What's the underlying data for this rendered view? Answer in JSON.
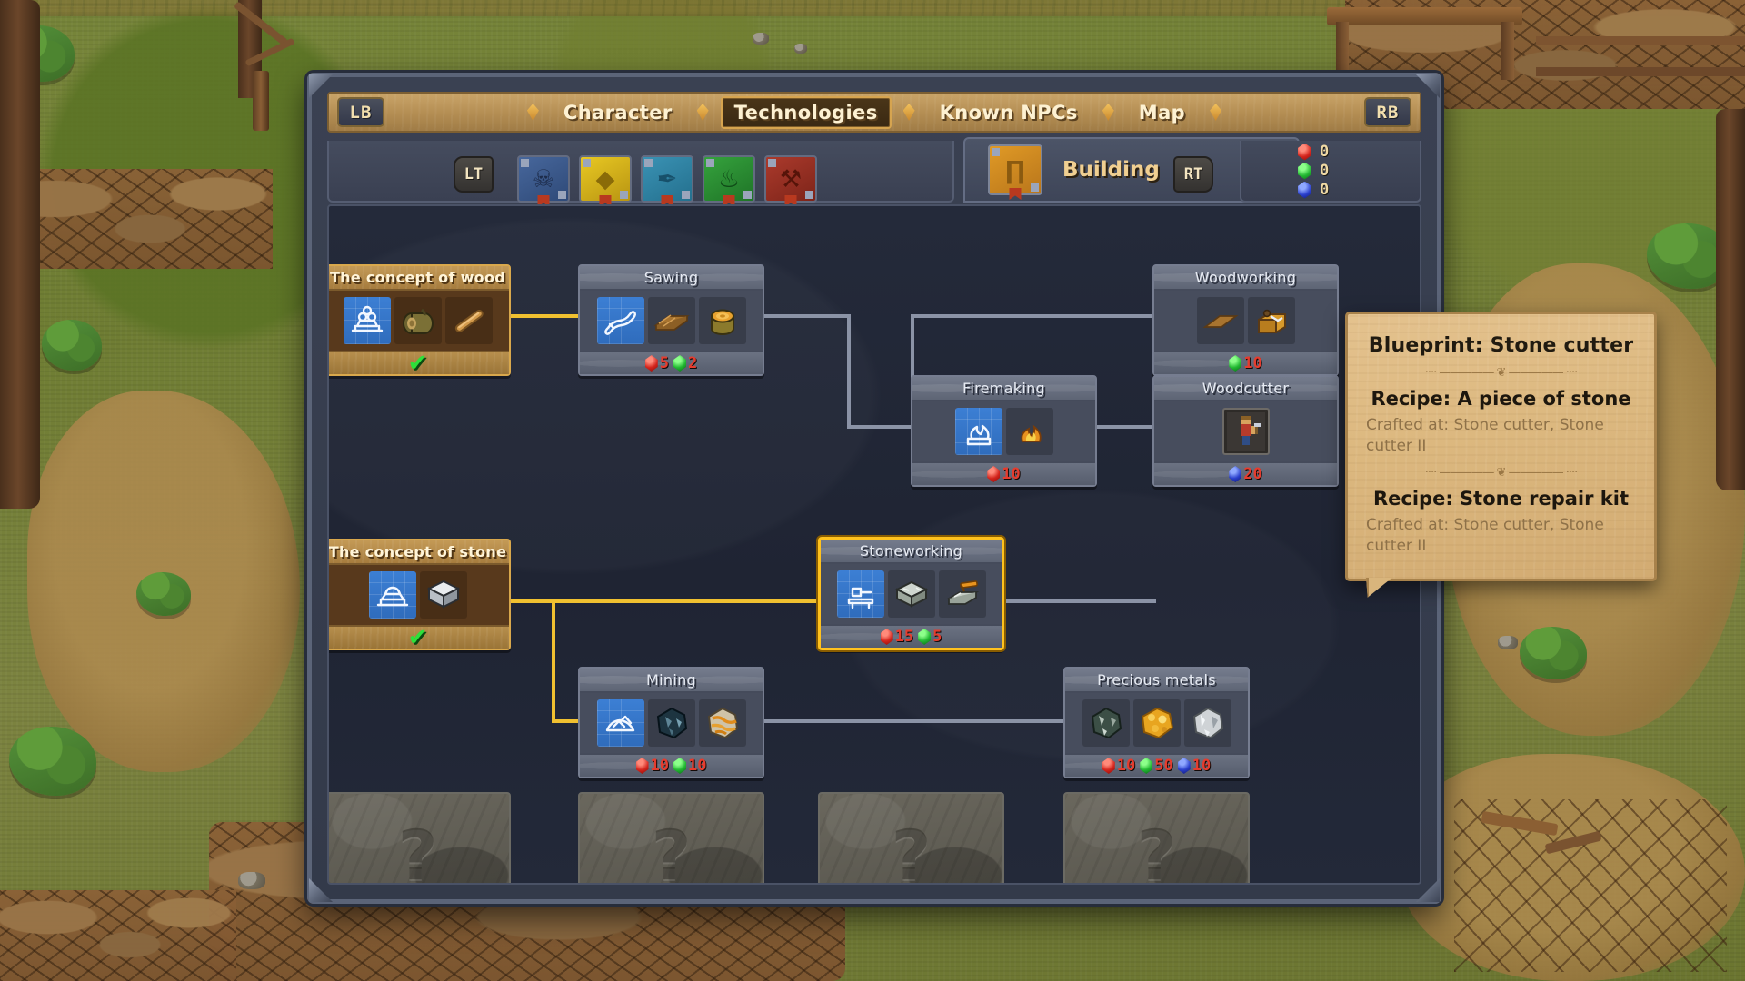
{
  "window": {
    "top_nav": {
      "left_bumper": "LB",
      "right_bumper": "RB",
      "tabs": [
        {
          "label": "Character",
          "active": false
        },
        {
          "label": "Technologies",
          "active": true
        },
        {
          "label": "Known NPCs",
          "active": false
        },
        {
          "label": "Map",
          "active": false
        }
      ]
    },
    "category_bar": {
      "left_trigger": "LT",
      "right_trigger": "RT",
      "books": [
        {
          "name": "skull-book-icon",
          "color": "#3d5c8f",
          "glyph": "☠"
        },
        {
          "name": "eye-book-icon",
          "color": "#d8b019",
          "glyph": "◈"
        },
        {
          "name": "feather-book-icon",
          "color": "#2f7f9e",
          "glyph": "✒"
        },
        {
          "name": "plant-book-icon",
          "color": "#2c8a33",
          "glyph": "⚘"
        },
        {
          "name": "anvil-book-icon",
          "color": "#9e3029",
          "glyph": "⚒"
        }
      ],
      "selected": {
        "label": "Building",
        "icon": "building-book-icon",
        "color": "#d1901f"
      },
      "gems": [
        {
          "type": "red",
          "color": "#d4241c",
          "count": "0"
        },
        {
          "type": "green",
          "color": "#22b832",
          "count": "0"
        },
        {
          "type": "blue",
          "color": "#2a3fcc",
          "count": "0"
        }
      ]
    }
  },
  "tree": {
    "nodes": [
      {
        "id": "concept-of-wood",
        "title": "The concept of wood",
        "state": "unlocked",
        "checkmark": "✔",
        "items": [
          "blueprint-wood-pile",
          "log-item",
          "wooden-stick-item"
        ],
        "costs": []
      },
      {
        "id": "sawing",
        "title": "Sawing",
        "state": "available",
        "items": [
          "blueprint-saw",
          "planks-item",
          "tree-stump-item"
        ],
        "costs": [
          {
            "type": "red",
            "value": "5"
          },
          {
            "type": "green",
            "value": "2"
          }
        ]
      },
      {
        "id": "woodworking",
        "title": "Woodworking",
        "title_visible": "rking",
        "state": "available",
        "items": [
          "blueprint-plank",
          "workbench-item"
        ],
        "costs": [
          {
            "type": "green",
            "value": "10"
          }
        ]
      },
      {
        "id": "firemaking",
        "title": "Firemaking",
        "title_visible": "Fire",
        "state": "available",
        "items": [
          "blueprint-fire",
          "campfire-item"
        ],
        "costs": [
          {
            "type": "red",
            "value": "10"
          }
        ]
      },
      {
        "id": "woodcutter",
        "title": "Woodcutter",
        "title_visible": "utter",
        "state": "available",
        "items": [
          "lumberjack-npc-item"
        ],
        "costs": [
          {
            "type": "blue",
            "value": "20"
          }
        ]
      },
      {
        "id": "concept-of-stone",
        "title": "The concept of stone",
        "state": "unlocked",
        "checkmark": "✔",
        "items": [
          "blueprint-stone-pile",
          "stone-block-item"
        ],
        "costs": []
      },
      {
        "id": "stoneworking",
        "title": "Stoneworking",
        "state": "selected",
        "items": [
          "blueprint-anvil",
          "stone-block-item",
          "stone-cutter-item"
        ],
        "costs": [
          {
            "type": "red",
            "value": "15"
          },
          {
            "type": "green",
            "value": "5"
          }
        ]
      },
      {
        "id": "mining",
        "title": "Mining",
        "state": "available",
        "items": [
          "blueprint-ore-pile",
          "coal-ore-item",
          "copper-ore-item"
        ],
        "costs": [
          {
            "type": "red",
            "value": "10"
          },
          {
            "type": "green",
            "value": "10"
          }
        ]
      },
      {
        "id": "precious-metals",
        "title": "Precious metals",
        "state": "available",
        "items": [
          "iron-ore-item",
          "gold-nugget-item",
          "silver-ore-item"
        ],
        "costs": [
          {
            "type": "red",
            "value": "10"
          },
          {
            "type": "green",
            "value": "50"
          },
          {
            "type": "blue",
            "value": "10"
          }
        ]
      }
    ],
    "hidden_nodes": [
      {
        "id": "hidden-1",
        "glyph": "?"
      },
      {
        "id": "hidden-2",
        "glyph": "?"
      },
      {
        "id": "hidden-3",
        "glyph": "?"
      },
      {
        "id": "hidden-4",
        "glyph": "?"
      }
    ]
  },
  "tooltip": {
    "title": "Blueprint: Stone cutter",
    "separator": "···· ————— ❦ ————— ····",
    "entries": [
      {
        "recipe": "Recipe: A piece of stone",
        "crafted_at": "Crafted at: Stone cutter, Stone cutter II"
      },
      {
        "recipe": "Recipe: Stone repair kit",
        "crafted_at": "Crafted at: Stone cutter, Stone cutter II"
      }
    ]
  }
}
